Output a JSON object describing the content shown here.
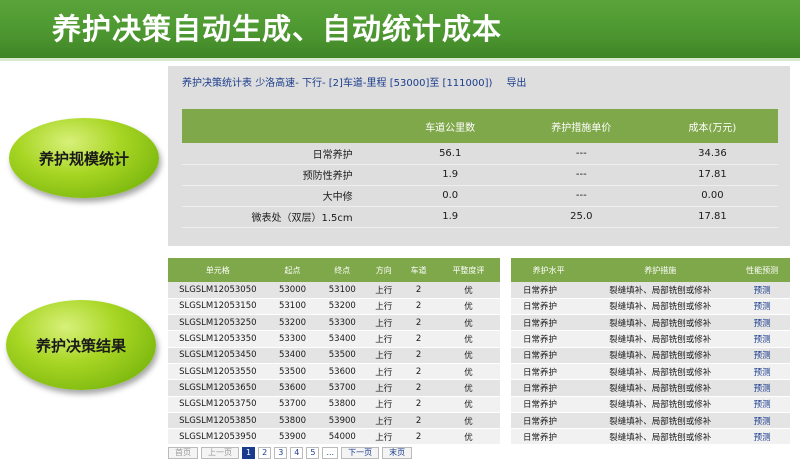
{
  "banner": {
    "title": "养护决策自动生成、自动统计成本"
  },
  "ovals": {
    "scale_stats": "养护规模统计",
    "decision_results": "养护决策结果"
  },
  "stats": {
    "header": {
      "prefix": "养护决策统计表 ",
      "road": "少洛高速",
      "sep1": "- 下行- ",
      "lane": "[2]",
      "mileage_label": "车道-里程 ",
      "start": "[53000]",
      "to": "至 ",
      "end": "[111000])",
      "export": "导出"
    },
    "columns": [
      "",
      "车道公里数",
      "养护措施单价",
      "成本(万元)"
    ],
    "rows": [
      {
        "name": "日常养护",
        "km": "56.1",
        "price": "---",
        "cost": "34.36"
      },
      {
        "name": "预防性养护",
        "km": "1.9",
        "price": "---",
        "cost": "17.81"
      },
      {
        "name": "大中修",
        "km": "0.0",
        "price": "---",
        "cost": "0.00"
      },
      {
        "name": "微表处（双层）1.5cm",
        "km": "1.9",
        "price": "25.0",
        "cost": "17.81"
      }
    ]
  },
  "results_left": {
    "columns": [
      "单元格",
      "起点",
      "终点",
      "方向",
      "车道",
      "平整度评"
    ],
    "rows": [
      {
        "unit": "SLGSLM12053050",
        "start": "53000",
        "end": "53100",
        "dir": "上行",
        "lane": "2",
        "grade": "优"
      },
      {
        "unit": "SLGSLM12053150",
        "start": "53100",
        "end": "53200",
        "dir": "上行",
        "lane": "2",
        "grade": "优"
      },
      {
        "unit": "SLGSLM12053250",
        "start": "53200",
        "end": "53300",
        "dir": "上行",
        "lane": "2",
        "grade": "优"
      },
      {
        "unit": "SLGSLM12053350",
        "start": "53300",
        "end": "53400",
        "dir": "上行",
        "lane": "2",
        "grade": "优"
      },
      {
        "unit": "SLGSLM12053450",
        "start": "53400",
        "end": "53500",
        "dir": "上行",
        "lane": "2",
        "grade": "优"
      },
      {
        "unit": "SLGSLM12053550",
        "start": "53500",
        "end": "53600",
        "dir": "上行",
        "lane": "2",
        "grade": "优"
      },
      {
        "unit": "SLGSLM12053650",
        "start": "53600",
        "end": "53700",
        "dir": "上行",
        "lane": "2",
        "grade": "优"
      },
      {
        "unit": "SLGSLM12053750",
        "start": "53700",
        "end": "53800",
        "dir": "上行",
        "lane": "2",
        "grade": "优"
      },
      {
        "unit": "SLGSLM12053850",
        "start": "53800",
        "end": "53900",
        "dir": "上行",
        "lane": "2",
        "grade": "优"
      },
      {
        "unit": "SLGSLM12053950",
        "start": "53900",
        "end": "54000",
        "dir": "上行",
        "lane": "2",
        "grade": "优"
      }
    ]
  },
  "results_right": {
    "columns": [
      "养护水平",
      "养护措施",
      "性能预测"
    ],
    "rows": [
      {
        "level": "日常养护",
        "measure": "裂缝填补、局部铣刨或修补",
        "predict": "预测"
      },
      {
        "level": "日常养护",
        "measure": "裂缝填补、局部铣刨或修补",
        "predict": "预测"
      },
      {
        "level": "日常养护",
        "measure": "裂缝填补、局部铣刨或修补",
        "predict": "预测"
      },
      {
        "level": "日常养护",
        "measure": "裂缝填补、局部铣刨或修补",
        "predict": "预测"
      },
      {
        "level": "日常养护",
        "measure": "裂缝填补、局部铣刨或修补",
        "predict": "预测"
      },
      {
        "level": "日常养护",
        "measure": "裂缝填补、局部铣刨或修补",
        "predict": "预测"
      },
      {
        "level": "日常养护",
        "measure": "裂缝填补、局部铣刨或修补",
        "predict": "预测"
      },
      {
        "level": "日常养护",
        "measure": "裂缝填补、局部铣刨或修补",
        "predict": "预测"
      },
      {
        "level": "日常养护",
        "measure": "裂缝填补、局部铣刨或修补",
        "predict": "预测"
      },
      {
        "level": "日常养护",
        "measure": "裂缝填补、局部铣刨或修补",
        "predict": "预测"
      }
    ]
  },
  "pager": {
    "first": "首页",
    "prev": "上一页",
    "pages": [
      "1",
      "2",
      "3",
      "4",
      "5"
    ],
    "ellipsis": "...",
    "next": "下一页",
    "last": "末页",
    "current": "1"
  },
  "colors": {
    "banner": "#4c9630",
    "table_header": "#7fa84a",
    "link": "#1a3c8c",
    "oval": "#a8d624"
  }
}
